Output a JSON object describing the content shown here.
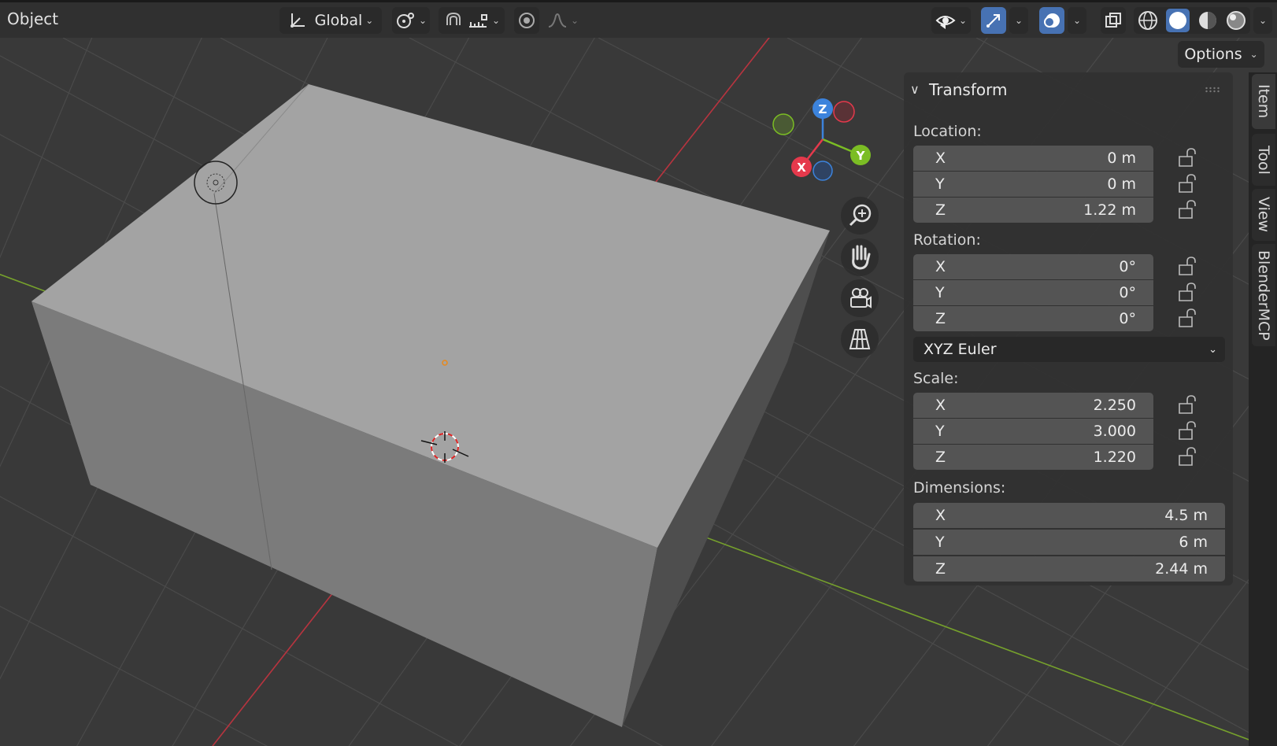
{
  "header": {
    "mode": "Object",
    "orientation": "Global",
    "icons": [
      "transform-orientation-icon",
      "pivot-icon",
      "snap-icon",
      "snap-increment-icon",
      "proportional-edit-icon",
      "falloff-icon",
      "visibility-icon",
      "gizmo-icon",
      "overlay-icon",
      "xray-icon",
      "wireframe-shading-icon",
      "solid-shading-icon",
      "material-shading-icon",
      "rendered-shading-icon"
    ]
  },
  "options": {
    "label": "Options"
  },
  "panel": {
    "title": "Transform",
    "location": {
      "label": "Location:",
      "x": {
        "axis": "X",
        "value": "0 m"
      },
      "y": {
        "axis": "Y",
        "value": "0 m"
      },
      "z": {
        "axis": "Z",
        "value": "1.22 m"
      }
    },
    "rotation": {
      "label": "Rotation:",
      "x": {
        "axis": "X",
        "value": "0°"
      },
      "y": {
        "axis": "Y",
        "value": "0°"
      },
      "z": {
        "axis": "Z",
        "value": "0°"
      }
    },
    "rotation_mode": "XYZ Euler",
    "scale": {
      "label": "Scale:",
      "x": {
        "axis": "X",
        "value": "2.250"
      },
      "y": {
        "axis": "Y",
        "value": "3.000"
      },
      "z": {
        "axis": "Z",
        "value": "1.220"
      }
    },
    "dimensions": {
      "label": "Dimensions:",
      "x": {
        "axis": "X",
        "value": "4.5 m"
      },
      "y": {
        "axis": "Y",
        "value": "6 m"
      },
      "z": {
        "axis": "Z",
        "value": "2.44 m"
      }
    }
  },
  "tabs": [
    "Item",
    "Tool",
    "View",
    "BlenderMCP"
  ],
  "gizmo": {
    "x": "X",
    "y": "Y",
    "z": "Z"
  },
  "colors": {
    "x_axis": "#e5394c",
    "y_axis": "#7bbd24",
    "z_axis": "#3c83dc",
    "accent": "#4772b3",
    "background": "#393939"
  }
}
